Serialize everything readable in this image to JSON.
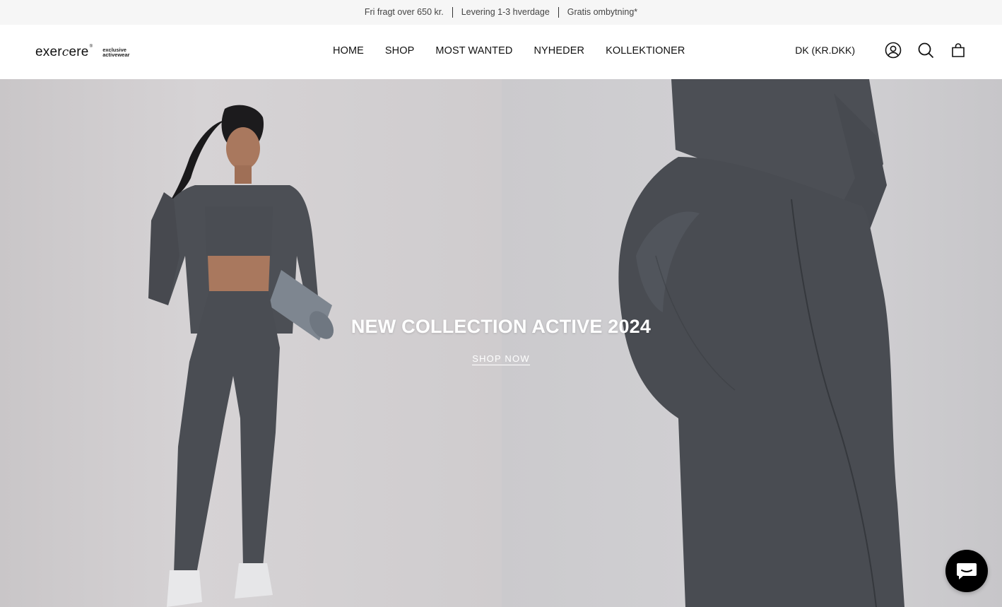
{
  "announcement": {
    "messages": [
      "Fri fragt over 650 kr.",
      "Levering 1-3 hverdage",
      "Gratis ombytning*"
    ]
  },
  "header": {
    "logo": {
      "word_start": "exer",
      "word_c": "c",
      "word_end": "ere",
      "reg": "®",
      "tagline_1": "exclusive",
      "tagline_2": "activewear"
    },
    "nav": [
      "HOME",
      "SHOP",
      "MOST WANTED",
      "NYHEDER",
      "KOLLEKTIONER"
    ],
    "currency": "DK (KR.DKK)",
    "icons": [
      "account-icon",
      "search-icon",
      "cart-icon"
    ]
  },
  "hero": {
    "title": "NEW COLLECTION ACTIVE 2024",
    "cta": "SHOP NOW"
  },
  "chat": {
    "icon": "chat-icon",
    "color": "#000000"
  },
  "colors": {
    "announcement_bg": "#f6f6f6",
    "garment": "#4a4d53",
    "hero_text": "#ffffff"
  }
}
